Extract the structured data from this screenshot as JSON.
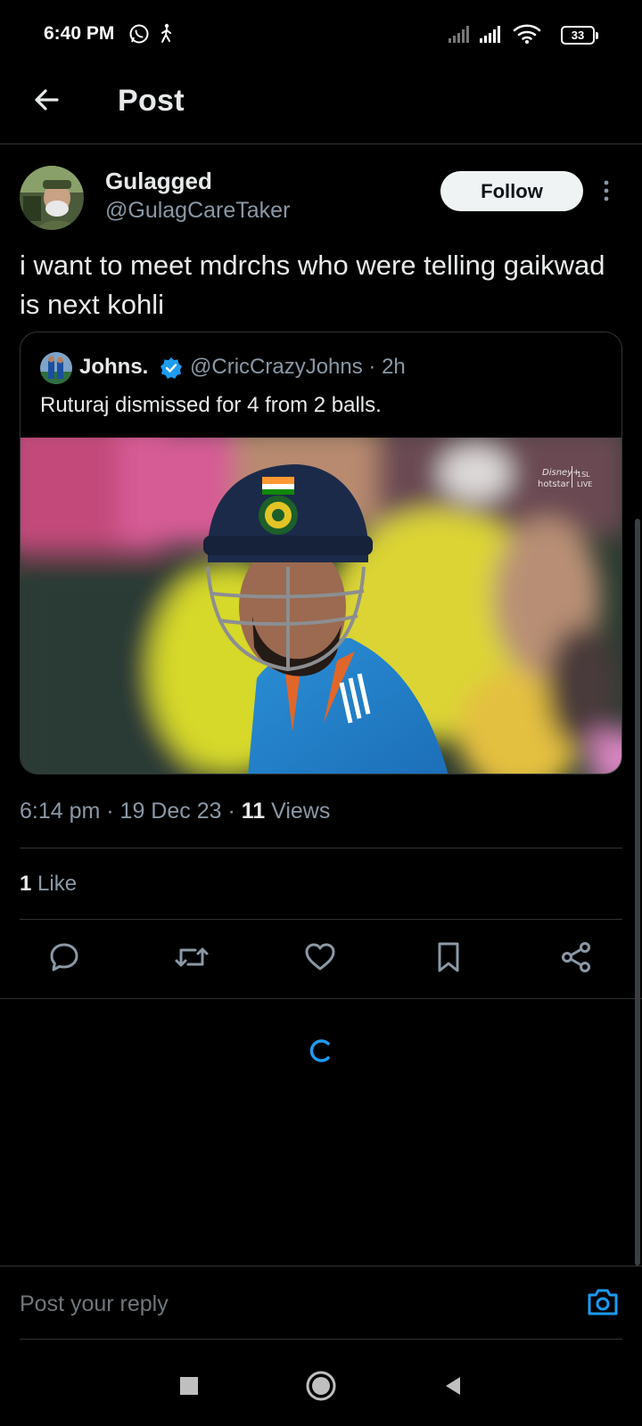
{
  "status_bar": {
    "time": "6:40 PM",
    "battery": "33",
    "icons": [
      "whatsapp-icon",
      "walk-icon",
      "signal-icon",
      "signal-icon",
      "wifi-icon",
      "battery-icon"
    ]
  },
  "header": {
    "title": "Post",
    "back_icon": "arrow-left-icon"
  },
  "post": {
    "author_name": "Gulagged",
    "author_handle": "@GulagCareTaker",
    "follow_label": "Follow",
    "text": "i want to meet mdrchs who were telling gaikwad is next kohli",
    "timestamp": "6:14 pm · 19 Dec 23 · ",
    "views_count": "11",
    "views_label": " Views",
    "likes_count": "1",
    "likes_label": " Like"
  },
  "quote": {
    "author_name": "Johns.",
    "author_handle": "@CricCrazyJohns · 2h",
    "text": "Ruturaj dismissed for 4 from 2 balls.",
    "media_overlay": {
      "brand_line1": "Disney+",
      "brand_line2": "hotstar",
      "badge_line1": "1SL",
      "badge_line2": "LIVE"
    }
  },
  "actions": [
    "reply-icon",
    "retweet-icon",
    "like-icon",
    "bookmark-icon",
    "share-icon"
  ],
  "reply_bar": {
    "placeholder": "Post your reply",
    "camera_icon": "camera-icon"
  },
  "nav_bar": [
    "recents-icon",
    "home-icon",
    "back-icon"
  ],
  "colors": {
    "background": "#000000",
    "text": "#e7e9ea",
    "secondary": "#8b98a5",
    "accent": "#1d9bf0",
    "border": "#2f3336"
  }
}
